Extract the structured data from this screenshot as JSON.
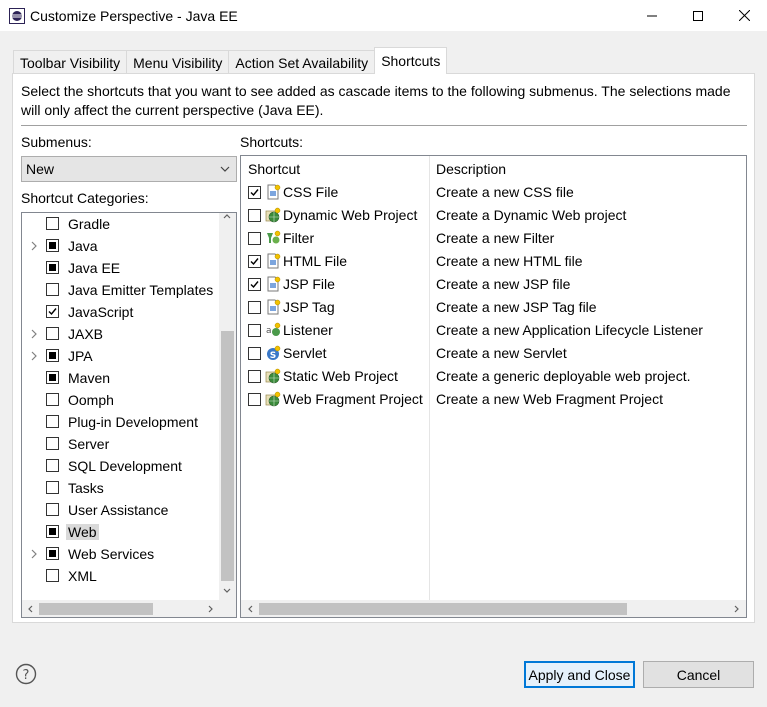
{
  "window": {
    "title": "Customize Perspective - Java EE"
  },
  "tabs": [
    {
      "label": "Toolbar Visibility",
      "active": false
    },
    {
      "label": "Menu Visibility",
      "active": false
    },
    {
      "label": "Action Set Availability",
      "active": false
    },
    {
      "label": "Shortcuts",
      "active": true
    }
  ],
  "description": "Select the shortcuts that you want to see added as cascade items to the following submenus. The selections made will only affect the current perspective (Java EE).",
  "submenus": {
    "label": "Submenus:",
    "selected": "New"
  },
  "categories": {
    "label": "Shortcut Categories:",
    "items": [
      {
        "label": "Gradle",
        "state": "unchecked",
        "expandable": false
      },
      {
        "label": "Java",
        "state": "partial",
        "expandable": true
      },
      {
        "label": "Java EE",
        "state": "partial",
        "expandable": false
      },
      {
        "label": "Java Emitter Templates",
        "state": "unchecked",
        "expandable": false
      },
      {
        "label": "JavaScript",
        "state": "checked",
        "expandable": false
      },
      {
        "label": "JAXB",
        "state": "unchecked",
        "expandable": true
      },
      {
        "label": "JPA",
        "state": "partial",
        "expandable": true
      },
      {
        "label": "Maven",
        "state": "partial",
        "expandable": false
      },
      {
        "label": "Oomph",
        "state": "unchecked",
        "expandable": false
      },
      {
        "label": "Plug-in Development",
        "state": "unchecked",
        "expandable": false
      },
      {
        "label": "Server",
        "state": "unchecked",
        "expandable": false
      },
      {
        "label": "SQL Development",
        "state": "unchecked",
        "expandable": false
      },
      {
        "label": "Tasks",
        "state": "unchecked",
        "expandable": false
      },
      {
        "label": "User Assistance",
        "state": "unchecked",
        "expandable": false
      },
      {
        "label": "Web",
        "state": "partial",
        "expandable": false,
        "selected": true
      },
      {
        "label": "Web Services",
        "state": "partial",
        "expandable": true
      },
      {
        "label": "XML",
        "state": "unchecked",
        "expandable": false
      }
    ]
  },
  "shortcuts": {
    "label": "Shortcuts:",
    "columns": [
      "Shortcut",
      "Description"
    ],
    "rows": [
      {
        "name": "CSS File",
        "description": "Create a new CSS file",
        "checked": true,
        "icon": "css-file-icon",
        "color": "#5b8ed6"
      },
      {
        "name": "Dynamic Web Project",
        "description": "Create a Dynamic Web project",
        "checked": false,
        "icon": "web-project-icon",
        "color": "#3a8a3a"
      },
      {
        "name": "Filter",
        "description": "Create a new Filter",
        "checked": false,
        "icon": "filter-icon",
        "color": "#4a9a4a"
      },
      {
        "name": "HTML File",
        "description": "Create a new HTML file",
        "checked": true,
        "icon": "html-file-icon",
        "color": "#5b8ed6"
      },
      {
        "name": "JSP File",
        "description": "Create a new JSP file",
        "checked": true,
        "icon": "jsp-file-icon",
        "color": "#5b8ed6"
      },
      {
        "name": "JSP Tag",
        "description": "Create a new JSP Tag file",
        "checked": false,
        "icon": "jsp-tag-icon",
        "color": "#5b8ed6"
      },
      {
        "name": "Listener",
        "description": "Create a new Application Lifecycle Listener",
        "checked": false,
        "icon": "listener-icon",
        "color": "#4a9a4a"
      },
      {
        "name": "Servlet",
        "description": "Create a new Servlet",
        "checked": false,
        "icon": "servlet-icon",
        "color": "#3a78c8"
      },
      {
        "name": "Static Web Project",
        "description": "Create a generic deployable web project.",
        "checked": false,
        "icon": "static-web-project-icon",
        "color": "#3a8a3a"
      },
      {
        "name": "Web Fragment Project",
        "description": "Create a new Web Fragment Project",
        "checked": false,
        "icon": "web-fragment-project-icon",
        "color": "#3a8a3a"
      }
    ]
  },
  "buttons": {
    "apply_close": "Apply and Close",
    "cancel": "Cancel"
  },
  "colors": {
    "accent": "#0078d7",
    "panel": "#ffffff",
    "background": "#f0f0f0"
  }
}
